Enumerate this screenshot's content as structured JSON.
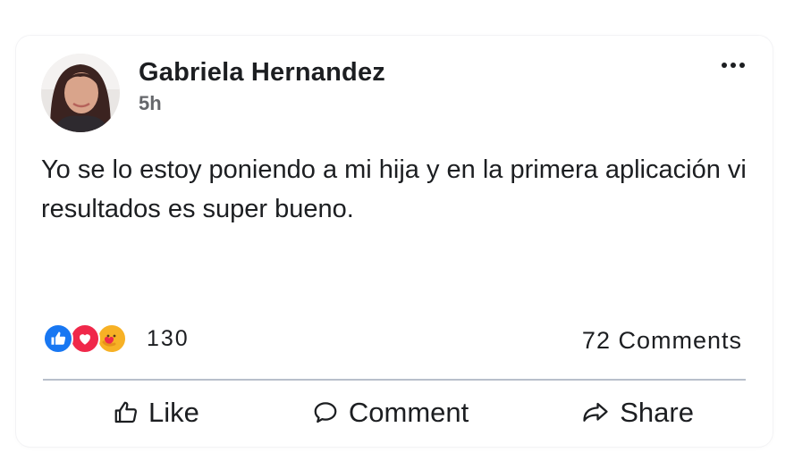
{
  "post": {
    "author": "Gabriela Hernandez",
    "time": "5h",
    "text": "Yo se lo estoy poniendo a mi hija y en la primera aplicación vi resultados es super bueno.",
    "reaction_count": "130",
    "reaction_icons": [
      "like-icon",
      "love-icon",
      "care-icon"
    ],
    "comments_label": "72 Comments"
  },
  "actions": {
    "like": "Like",
    "comment": "Comment",
    "share": "Share"
  },
  "colors": {
    "like": "#1877f2",
    "love": "#f0284a",
    "care": "#f7b125",
    "text": "#1c1e21",
    "muted": "#65676b"
  }
}
